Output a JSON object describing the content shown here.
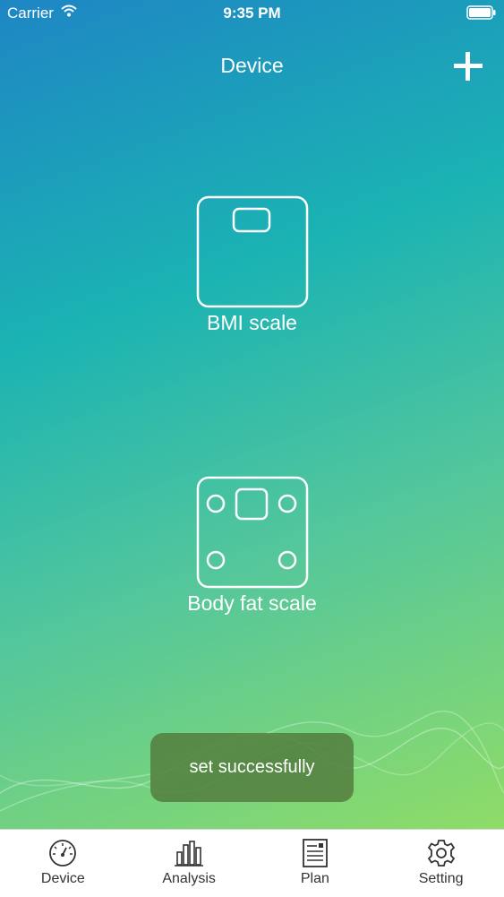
{
  "status_bar": {
    "carrier": "Carrier",
    "time": "9:35 PM",
    "wifi_icon": "wifi-icon",
    "battery_icon": "battery-icon"
  },
  "nav": {
    "title": "Device",
    "add_icon": "plus-icon"
  },
  "devices": [
    {
      "label": "BMI scale",
      "icon": "bmi-scale-icon"
    },
    {
      "label": "Body fat scale",
      "icon": "body-fat-scale-icon"
    }
  ],
  "toast": {
    "message": "set successfully"
  },
  "tabs": [
    {
      "label": "Device",
      "icon": "gauge-icon"
    },
    {
      "label": "Analysis",
      "icon": "bar-chart-icon"
    },
    {
      "label": "Plan",
      "icon": "document-icon"
    },
    {
      "label": "Setting",
      "icon": "gear-icon"
    }
  ],
  "colors": {
    "gradient_top": "#1e86c4",
    "gradient_mid": "#1bb3b3",
    "gradient_bottom": "#8fdc67",
    "toast_bg": "#548040",
    "text": "#ffffff",
    "tab_text": "#333333"
  }
}
